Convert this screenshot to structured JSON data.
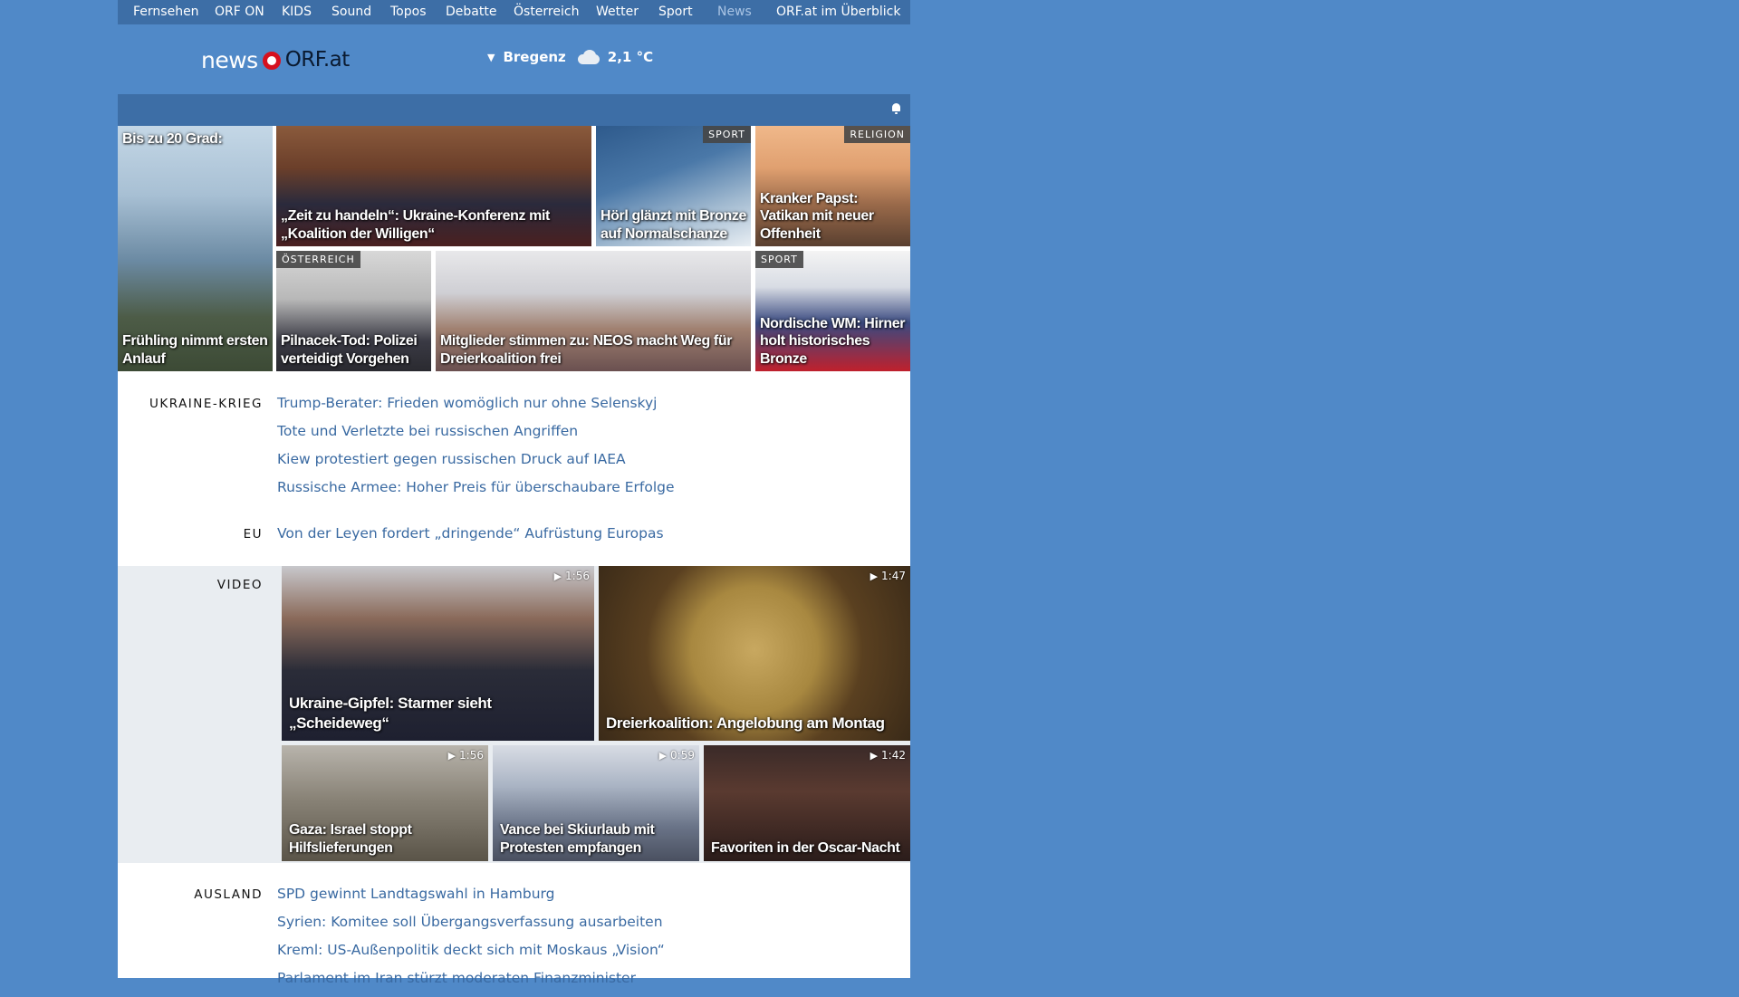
{
  "topnav": {
    "items": [
      "Fernsehen",
      "ORF ON",
      "KIDS",
      "Sound",
      "Topos",
      "Debatte",
      "Österreich",
      "Wetter",
      "Sport",
      "News"
    ],
    "overview": "ORF.at im Überblick"
  },
  "header": {
    "logo_news": "news",
    "logo_orf": "ORF.at",
    "weather_location": "Bregenz",
    "weather_icon": "cloud-icon",
    "weather_temp": "2,1 °C"
  },
  "top_tiles": [
    {
      "caption": "Bis zu 20 Grad:",
      "caption2": "Frühling nimmt ersten Anlauf",
      "tag": ""
    },
    {
      "caption": "„Zeit zu handeln“: Ukraine-Konferenz mit „Koalition der Willigen“",
      "tag": ""
    },
    {
      "caption": "Hörl glänzt mit Bronze auf Normalschanze",
      "tag": "SPORT"
    },
    {
      "caption": "Kranker Papst: Vatikan mit neuer Offenheit",
      "tag": "RELIGION"
    },
    {
      "caption": "Pilnacek-Tod: Polizei verteidigt Vorgehen",
      "tag": "ÖSTERREICH"
    },
    {
      "caption": "Mitglieder stimmen zu: NEOS macht Weg für Dreierkoalition frei",
      "tag": ""
    },
    {
      "caption": "Nordische WM: Hirner holt historisches Bronze",
      "tag": "SPORT"
    }
  ],
  "sections": {
    "ukraine": {
      "label": "UKRAINE-KRIEG",
      "links": [
        "Trump-Berater: Frieden womöglich nur ohne Selenskyj",
        "Tote und Verletzte bei russischen Angriffen",
        "Kiew protestiert gegen russischen Druck auf IAEA",
        "Russische Armee: Hoher Preis für überschaubare Erfolge"
      ]
    },
    "eu": {
      "label": "EU",
      "links": [
        "Von der Leyen fordert „dringende“ Aufrüstung Europas"
      ]
    },
    "video": {
      "label": "VIDEO",
      "items": [
        {
          "caption": "Ukraine-Gipfel: Starmer sieht „Scheideweg“",
          "duration": "1:56"
        },
        {
          "caption": "Dreierkoalition: Angelobung am Montag",
          "duration": "1:47"
        },
        {
          "caption": "Gaza: Israel stoppt Hilfslieferungen",
          "duration": "1:56"
        },
        {
          "caption": "Vance bei Skiurlaub mit Protesten empfangen",
          "duration": "0:59"
        },
        {
          "caption": "Favoriten in der Oscar-Nacht",
          "duration": "1:42"
        }
      ]
    },
    "ausland": {
      "label": "AUSLAND",
      "links": [
        "SPD gewinnt Landtagswahl in Hamburg",
        "Syrien: Komitee soll Übergangsverfassung ausarbeiten",
        "Kreml: US-Außenpolitik deckt sich mit Moskaus „Vision“",
        "Parlament im Iran stürzt moderaten Finanzminister"
      ]
    }
  },
  "colors": {
    "page_bg": "#5089c8",
    "nav_bg": "#3d6ea6",
    "link": "#3a6aa2",
    "logo_red": "#d6101e"
  }
}
